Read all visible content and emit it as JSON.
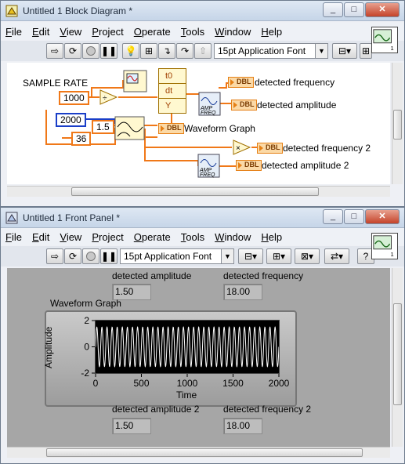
{
  "block_diagram": {
    "title": "Untitled 1 Block Diagram *",
    "menu": [
      "File",
      "Edit",
      "View",
      "Project",
      "Operate",
      "Tools",
      "Window",
      "Help"
    ],
    "font_selector": "15pt Application Font",
    "labels": {
      "sample_rate": "SAMPLE RATE",
      "detected_frequency": "detected frequency",
      "detected_amplitude": "detected amplitude",
      "waveform_graph": "Waveform Graph",
      "detected_frequency_2": "detected frequency 2",
      "detected_amplitude_2": "detected amplitude 2"
    },
    "constants": {
      "sample_rate_value": "1000",
      "count_value": "2000",
      "amplitude_value": "1.5",
      "frequency_value": "36"
    },
    "cluster_items": [
      "t0",
      "dt",
      "Y"
    ],
    "terminal_type": "DBL",
    "express_vi_text": "AMP\nFREQ",
    "colors": {
      "wire_orange": "#f07818",
      "wire_blue": "#1a3ec8",
      "terminal_fill": "#fbd9a6"
    }
  },
  "front_panel": {
    "title": "Untitled 1 Front Panel *",
    "menu": [
      "File",
      "Edit",
      "View",
      "Project",
      "Operate",
      "Tools",
      "Window",
      "Help"
    ],
    "font_selector": "15pt Application Font",
    "indicators": {
      "detected_amplitude_label": "detected amplitude",
      "detected_amplitude_value": "1.50",
      "detected_frequency_label": "detected frequency",
      "detected_frequency_value": "18.00",
      "detected_amplitude_2_label": "detected amplitude 2",
      "detected_amplitude_2_value": "1.50",
      "detected_frequency_2_label": "detected frequency 2",
      "detected_frequency_2_value": "18.00"
    },
    "graph": {
      "title": "Waveform Graph",
      "xlabel": "Time",
      "ylabel": "Amplitude",
      "x_ticks": [
        "0",
        "500",
        "1000",
        "1500",
        "2000"
      ],
      "y_ticks": [
        "2",
        "0",
        "-2"
      ],
      "xlim": [
        0,
        2000
      ],
      "ylim": [
        -2,
        2
      ],
      "amplitude": 1.5,
      "cycles": 36,
      "trace_color": "#ffffff"
    }
  }
}
